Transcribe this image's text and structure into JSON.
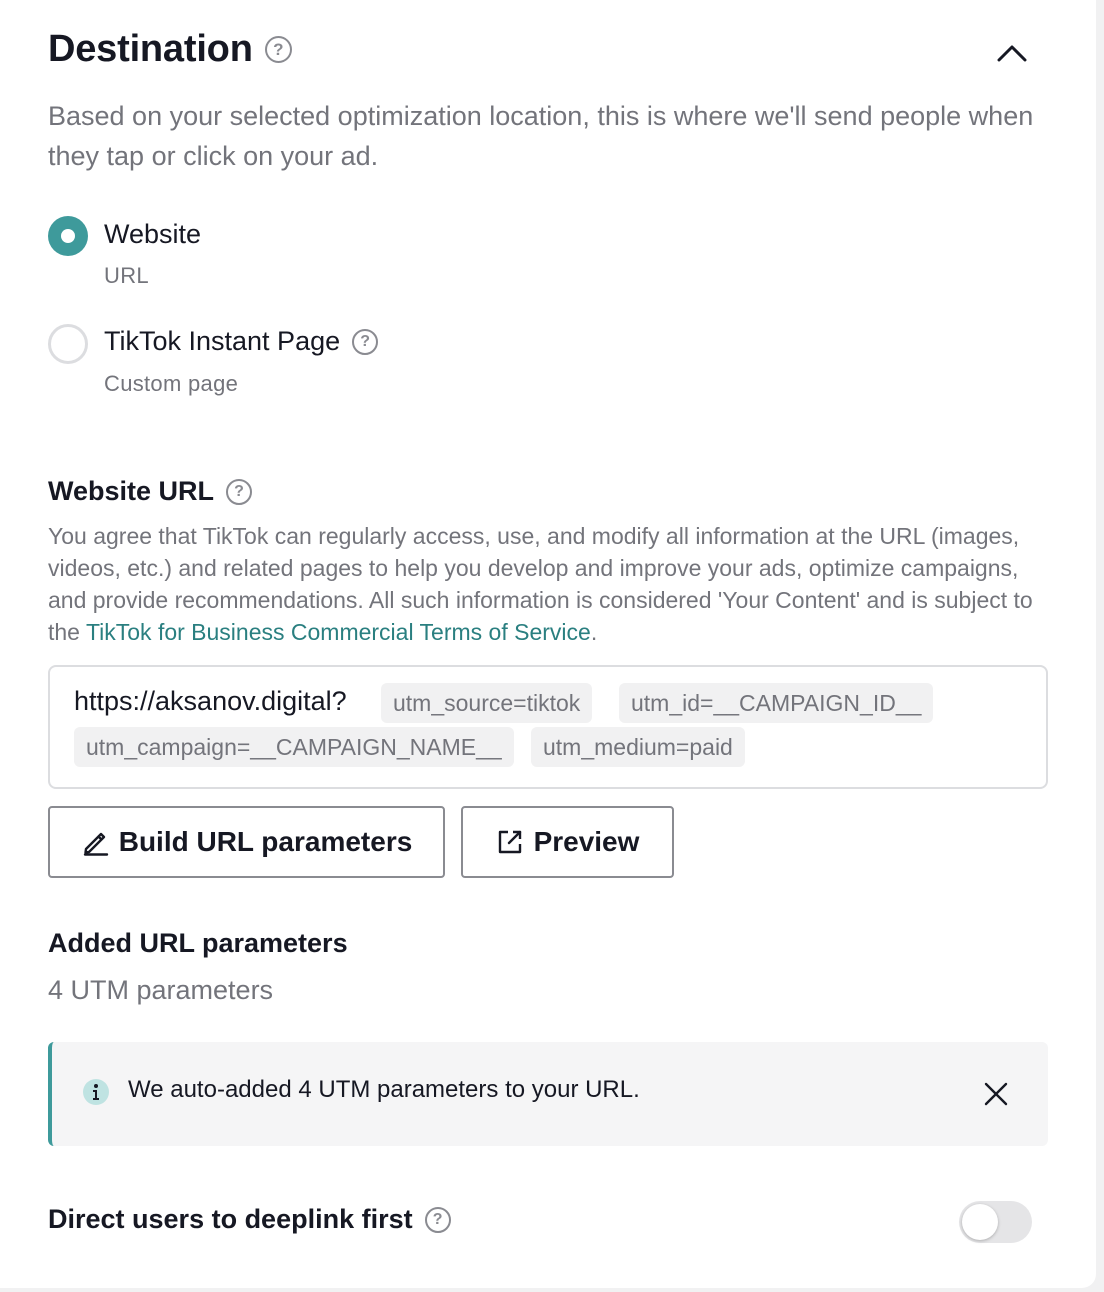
{
  "header": {
    "title": "Destination",
    "help_glyph": "?",
    "collapse_icon": "chevron-up-icon",
    "description": "Based on your selected optimization location, this is where we'll send people when they tap or click on your ad."
  },
  "options": [
    {
      "label": "Website",
      "sublabel": "URL",
      "selected": true
    },
    {
      "label": "TikTok Instant Page",
      "sublabel": "Custom page",
      "selected": false
    }
  ],
  "website_url": {
    "title": "Website URL",
    "legal_text": "You agree that TikTok can regularly access, use, and modify all information at the URL (images, videos, etc.) and related pages to help you develop and improve your ads, optimize campaigns, and provide recommendations. All such information is considered 'Your Content' and is subject to the ",
    "legal_link": "TikTok for Business Commercial Terms of Service",
    "legal_end": ".",
    "base_url": "https://aksanov.digital?",
    "params": [
      "utm_source=tiktok",
      "utm_id=__CAMPAIGN_ID__",
      "utm_campaign=__CAMPAIGN_NAME__",
      "utm_medium=paid"
    ]
  },
  "buttons": {
    "build": "Build URL parameters",
    "preview": "Preview"
  },
  "added_params": {
    "title": "Added URL parameters",
    "count_text": "4 UTM parameters"
  },
  "notice": {
    "icon": "info-icon",
    "text": "We auto-added 4 UTM parameters to your URL."
  },
  "deeplink": {
    "label": "Direct users to deeplink first",
    "enabled": false
  },
  "colors": {
    "accent": "#3e9a9b",
    "link": "#2a7f80",
    "muted_text": "#73747b",
    "primary_text": "#161823"
  }
}
